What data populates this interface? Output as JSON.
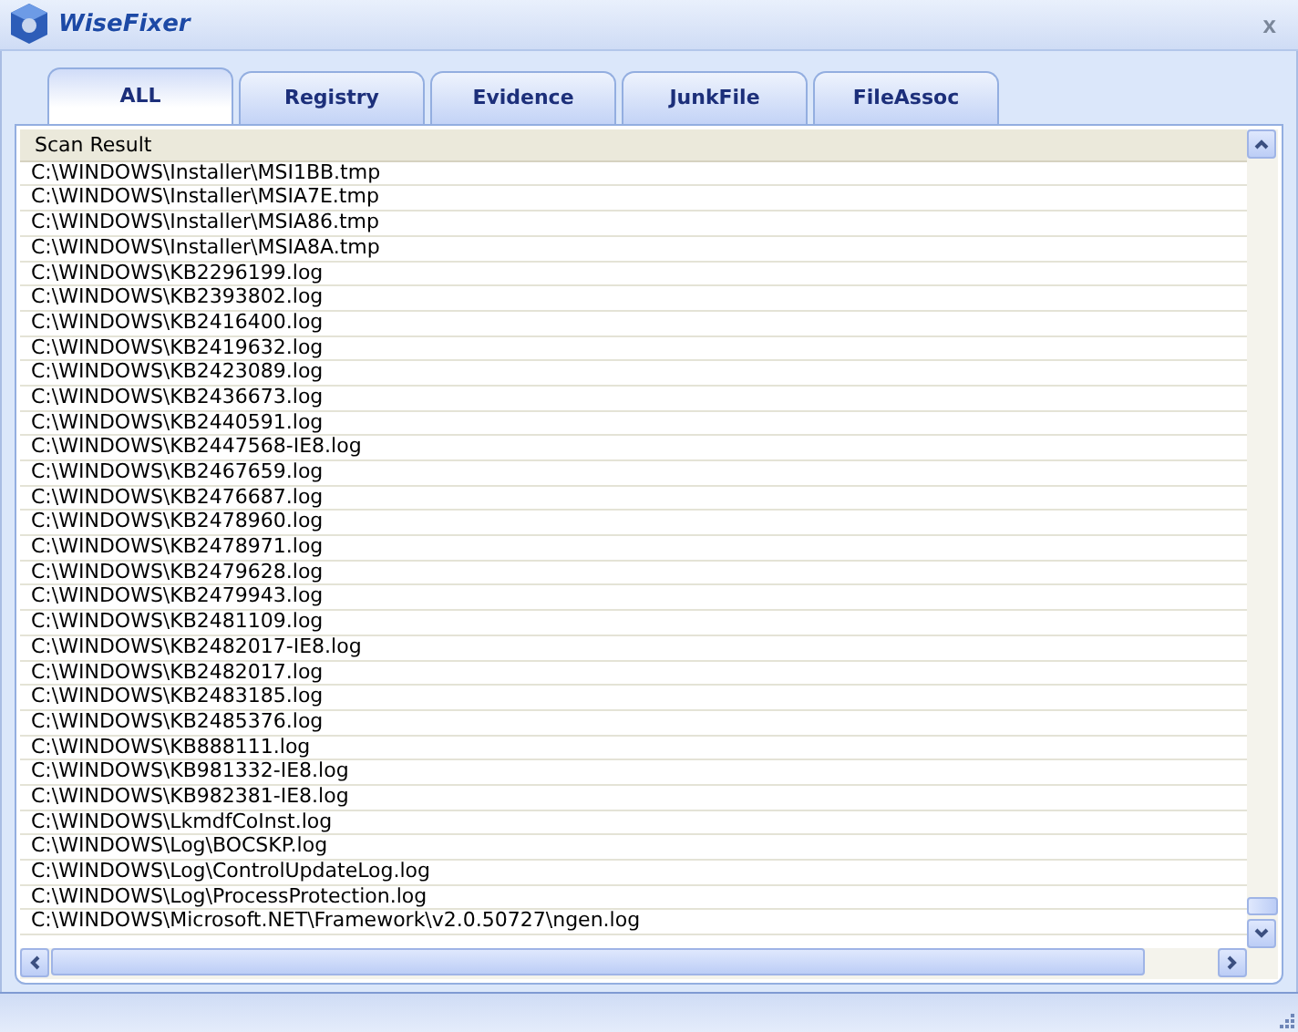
{
  "window": {
    "title": "WiseFixer",
    "close": "x"
  },
  "tabs": [
    {
      "label": "ALL",
      "selected": true
    },
    {
      "label": "Registry",
      "selected": false
    },
    {
      "label": "Evidence",
      "selected": false
    },
    {
      "label": "JunkFile",
      "selected": false
    },
    {
      "label": "FileAssoc",
      "selected": false
    }
  ],
  "list": {
    "header": "Scan Result",
    "rows": [
      "C:\\WINDOWS\\Installer\\MSI1BB.tmp",
      "C:\\WINDOWS\\Installer\\MSIA7E.tmp",
      "C:\\WINDOWS\\Installer\\MSIA86.tmp",
      "C:\\WINDOWS\\Installer\\MSIA8A.tmp",
      "C:\\WINDOWS\\KB2296199.log",
      "C:\\WINDOWS\\KB2393802.log",
      "C:\\WINDOWS\\KB2416400.log",
      "C:\\WINDOWS\\KB2419632.log",
      "C:\\WINDOWS\\KB2423089.log",
      "C:\\WINDOWS\\KB2436673.log",
      "C:\\WINDOWS\\KB2440591.log",
      "C:\\WINDOWS\\KB2447568-IE8.log",
      "C:\\WINDOWS\\KB2467659.log",
      "C:\\WINDOWS\\KB2476687.log",
      "C:\\WINDOWS\\KB2478960.log",
      "C:\\WINDOWS\\KB2478971.log",
      "C:\\WINDOWS\\KB2479628.log",
      "C:\\WINDOWS\\KB2479943.log",
      "C:\\WINDOWS\\KB2481109.log",
      "C:\\WINDOWS\\KB2482017-IE8.log",
      "C:\\WINDOWS\\KB2482017.log",
      "C:\\WINDOWS\\KB2483185.log",
      "C:\\WINDOWS\\KB2485376.log",
      "C:\\WINDOWS\\KB888111.log",
      "C:\\WINDOWS\\KB981332-IE8.log",
      "C:\\WINDOWS\\KB982381-IE8.log",
      "C:\\WINDOWS\\LkmdfCoInst.log",
      "C:\\WINDOWS\\Log\\BOCSKP.log",
      "C:\\WINDOWS\\Log\\ControlUpdateLog.log",
      "C:\\WINDOWS\\Log\\ProcessProtection.log",
      "C:\\WINDOWS\\Microsoft.NET\\Framework\\v2.0.50727\\ngen.log"
    ]
  }
}
